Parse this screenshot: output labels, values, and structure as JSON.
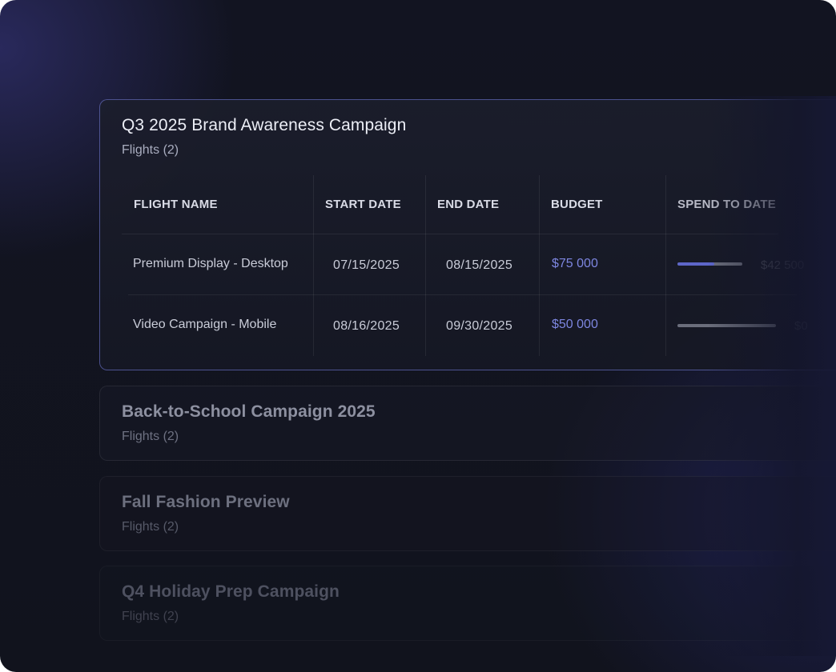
{
  "campaigns": [
    {
      "title": "Q3 2025 Brand Awareness Campaign",
      "subtitle": "Flights (2)",
      "table": {
        "headers": [
          "FLIGHT NAME",
          "START DATE",
          "END DATE",
          "BUDGET",
          "SPEND TO DATE"
        ],
        "rows": [
          {
            "flight_name": "Premium Display - Desktop",
            "start_date": "07/15/2025",
            "end_date": "08/15/2025",
            "budget": "$75 000",
            "spend": "$42 500",
            "spend_fraction": 0.57
          },
          {
            "flight_name": "Video Campaign - Mobile",
            "start_date": "08/16/2025",
            "end_date": "09/30/2025",
            "budget": "$50 000",
            "spend": "$0",
            "spend_fraction": 0
          }
        ]
      }
    },
    {
      "title": "Back-to-School Campaign 2025",
      "subtitle": "Flights (2)"
    },
    {
      "title": "Fall Fashion Preview",
      "subtitle": "Flights (2)"
    },
    {
      "title": "Q4 Holiday Prep Campaign",
      "subtitle": "Flights (2)"
    }
  ],
  "colors": {
    "accent": "#5d66c9",
    "budget_text": "#7d86e0",
    "background": "#11131d"
  }
}
